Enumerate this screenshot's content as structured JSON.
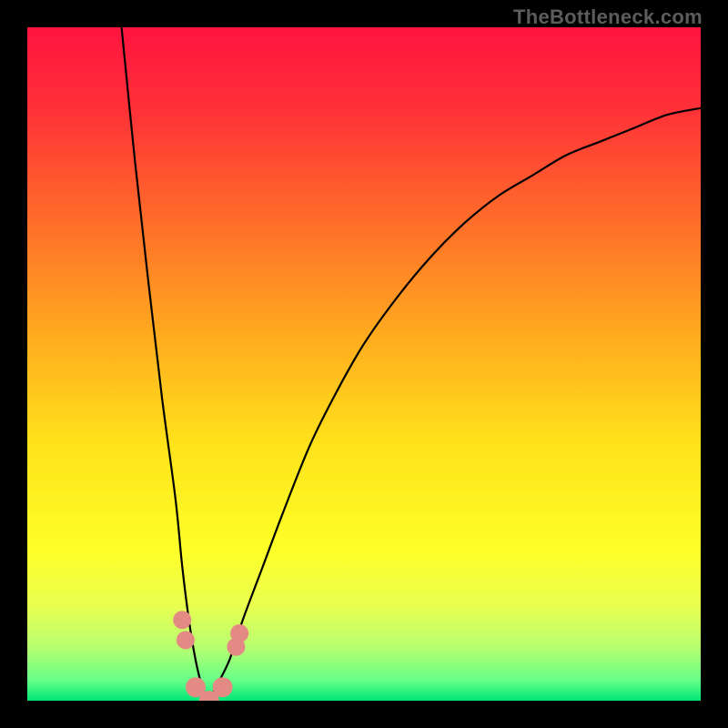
{
  "watermark": {
    "text": "TheBottleneck.com"
  },
  "chart_data": {
    "type": "line",
    "title": "",
    "xlabel": "",
    "ylabel": "",
    "xlim": [
      0,
      100
    ],
    "ylim": [
      0,
      100
    ],
    "grid": false,
    "legend": false,
    "background_gradient_stops": [
      {
        "offset": 0.0,
        "color": "#ff1440"
      },
      {
        "offset": 0.12,
        "color": "#ff3038"
      },
      {
        "offset": 0.28,
        "color": "#ff6a2a"
      },
      {
        "offset": 0.45,
        "color": "#ffa81f"
      },
      {
        "offset": 0.62,
        "color": "#ffe31a"
      },
      {
        "offset": 0.78,
        "color": "#fdff2a"
      },
      {
        "offset": 0.86,
        "color": "#e8ff50"
      },
      {
        "offset": 0.92,
        "color": "#b8ff70"
      },
      {
        "offset": 0.97,
        "color": "#66ff88"
      },
      {
        "offset": 1.0,
        "color": "#00e676"
      }
    ],
    "series": [
      {
        "name": "bottleneck-curve",
        "x": [
          14,
          16,
          18,
          20,
          22,
          23,
          24,
          25,
          26,
          27,
          28,
          30,
          32,
          35,
          38,
          42,
          46,
          50,
          55,
          60,
          65,
          70,
          75,
          80,
          85,
          90,
          95,
          100
        ],
        "y": [
          100,
          80,
          62,
          45,
          30,
          20,
          12,
          6,
          2,
          0,
          2,
          6,
          12,
          20,
          28,
          38,
          46,
          53,
          60,
          66,
          71,
          75,
          78,
          81,
          83,
          85,
          87,
          88
        ]
      }
    ],
    "markers": [
      {
        "name": "left-pink-blob",
        "x": 23.0,
        "y": 12,
        "color": "#e48a85",
        "r": 10
      },
      {
        "name": "left-pink-blob-2",
        "x": 23.5,
        "y": 9,
        "color": "#e48a85",
        "r": 10
      },
      {
        "name": "knee-left",
        "x": 25.0,
        "y": 2,
        "color": "#e48a85",
        "r": 11
      },
      {
        "name": "knee-center",
        "x": 27.0,
        "y": 0,
        "color": "#e48a85",
        "r": 11
      },
      {
        "name": "knee-right",
        "x": 29.0,
        "y": 2,
        "color": "#e48a85",
        "r": 11
      },
      {
        "name": "right-pink-blob",
        "x": 31.0,
        "y": 8,
        "color": "#e48a85",
        "r": 10
      },
      {
        "name": "right-pink-blob-2",
        "x": 31.5,
        "y": 10,
        "color": "#e48a85",
        "r": 10
      }
    ]
  }
}
